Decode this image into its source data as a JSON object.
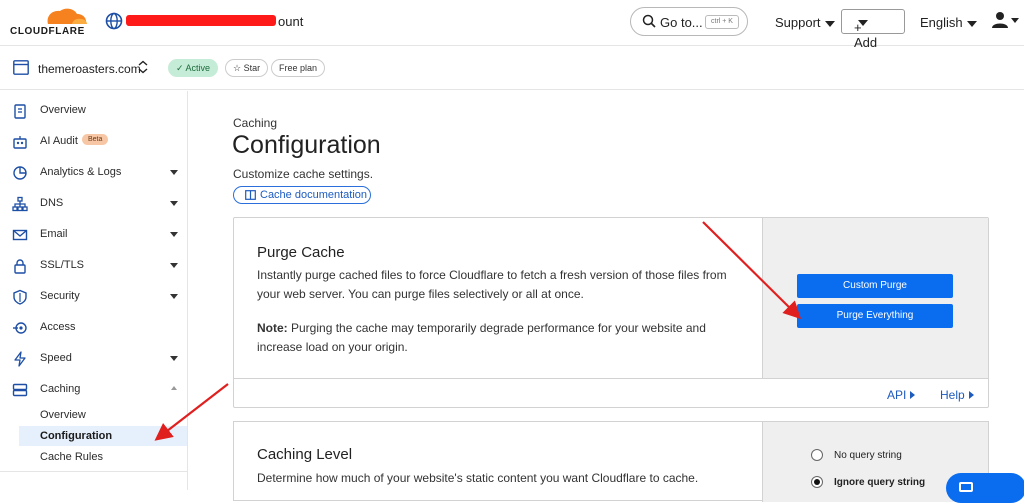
{
  "header": {
    "brand": "CLOUDFLARE",
    "account_suffix": "ount",
    "goto_label": "Go to...",
    "goto_kbd": "ctrl + K",
    "support": "Support",
    "add": "+ Add",
    "language": "English"
  },
  "zone": {
    "name": "themeroasters.com",
    "status": "Active",
    "star": "Star",
    "plan": "Free plan"
  },
  "sidebar": {
    "items": [
      {
        "label": "Overview"
      },
      {
        "label": "AI Audit",
        "badge": "Beta"
      },
      {
        "label": "Analytics & Logs"
      },
      {
        "label": "DNS"
      },
      {
        "label": "Email"
      },
      {
        "label": "SSL/TLS"
      },
      {
        "label": "Security"
      },
      {
        "label": "Access"
      },
      {
        "label": "Speed"
      },
      {
        "label": "Caching"
      }
    ],
    "caching_sub": [
      "Overview",
      "Configuration",
      "Cache Rules"
    ]
  },
  "main": {
    "breadcrumb": "Caching",
    "title": "Configuration",
    "description": "Customize cache settings.",
    "doc_link": "Cache documentation"
  },
  "purge": {
    "title": "Purge Cache",
    "text": "Instantly purge cached files to force Cloudflare to fetch a fresh version of those files from your web server. You can purge files selectively or all at once.",
    "note_label": "Note:",
    "note_text": " Purging the cache may temporarily degrade performance for your website and increase load on your origin.",
    "custom_purge": "Custom Purge",
    "purge_everything": "Purge Everything",
    "api": "API",
    "help": "Help"
  },
  "caching_level": {
    "title": "Caching Level",
    "text": "Determine how much of your website's static content you want Cloudflare to cache.",
    "options": [
      "No query string",
      "Ignore query string"
    ],
    "selected": 1
  },
  "colors": {
    "accent": "#0a6df0",
    "orange": "#f6821f",
    "annotation": "#e01f1f"
  }
}
